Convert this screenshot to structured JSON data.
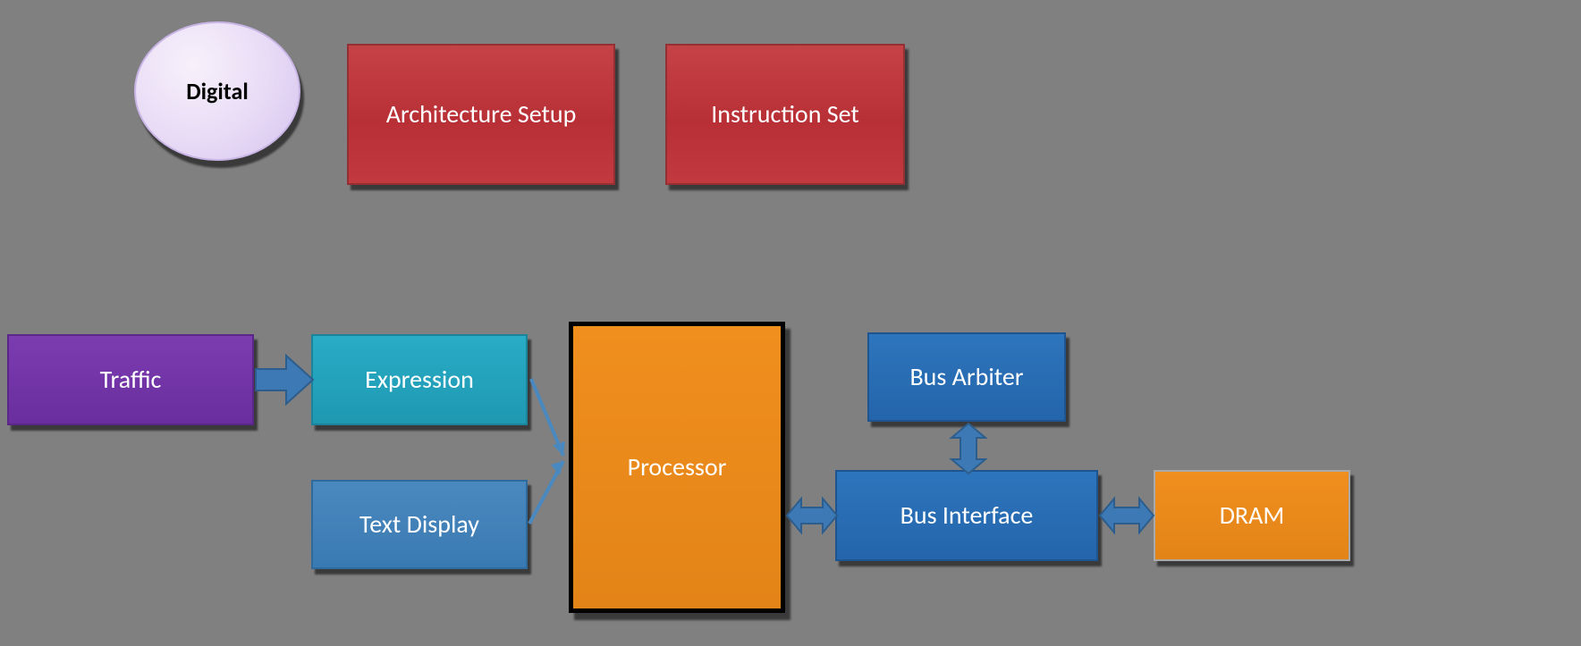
{
  "nodes": {
    "digital": "Digital",
    "architecture_setup": "Architecture Setup",
    "instruction_set": "Instruction Set",
    "traffic": "Traffic",
    "expression": "Expression",
    "text_display": "Text Display",
    "processor": "Processor",
    "bus_arbiter": "Bus Arbiter",
    "bus_interface": "Bus Interface",
    "dram": "DRAM"
  },
  "connections": [
    {
      "from": "traffic",
      "to": "expression",
      "type": "block-arrow-right"
    },
    {
      "from": "expression",
      "to": "processor",
      "type": "thin-arrow"
    },
    {
      "from": "text_display",
      "to": "processor",
      "type": "thin-arrow"
    },
    {
      "from": "processor",
      "to": "bus_interface",
      "type": "block-arrow-bidir-h"
    },
    {
      "from": "bus_arbiter",
      "to": "bus_interface",
      "type": "block-arrow-bidir-v"
    },
    {
      "from": "bus_interface",
      "to": "dram",
      "type": "block-arrow-bidir-h"
    }
  ]
}
